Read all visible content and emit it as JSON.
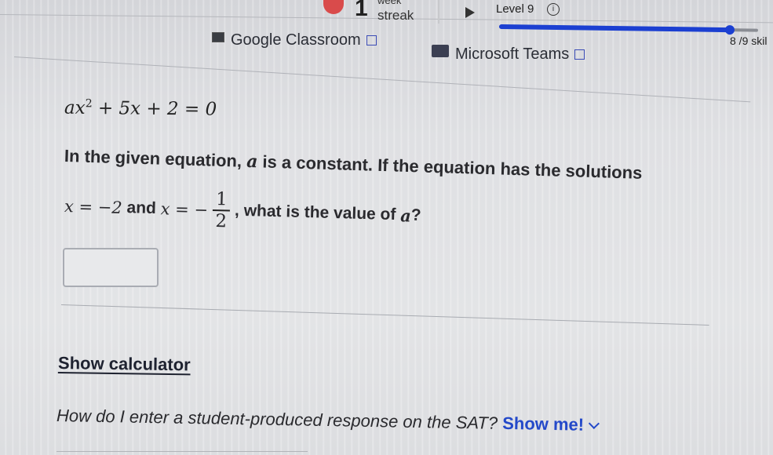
{
  "topbar": {
    "streak_number": "1",
    "streak_unit": "week",
    "streak_label": "streak",
    "level_label": "Level 9",
    "info_icon": "info-icon",
    "skills_text": "8 /9 skil",
    "progress_fraction": 0.89
  },
  "links": {
    "google_classroom": "Google Classroom",
    "microsoft_teams": "Microsoft Teams"
  },
  "question": {
    "equation_lhs_a": "ax",
    "equation_exp": "2",
    "equation_rest": " + 5x + 2 = 0",
    "line1_pre": "In the given equation, ",
    "line1_var": "a",
    "line1_post": " is a constant. If the equation has the solutions",
    "sol1": "x = −2",
    "and_text": " and ",
    "sol2_lhs": "x = −",
    "sol2_num": "1",
    "sol2_den": "2",
    "line2_post": ", what is the value of ",
    "line2_var": "a",
    "line2_end": "?"
  },
  "answer_input": {
    "value": "",
    "placeholder": ""
  },
  "calculator_link": "Show calculator",
  "help": {
    "question": "How do I enter a student-produced response on the SAT?",
    "show_me": "Show me!"
  },
  "colors": {
    "accent_blue": "#1b3fd1",
    "link_blue": "#2449c9",
    "streak_red": "#d94b4b"
  }
}
